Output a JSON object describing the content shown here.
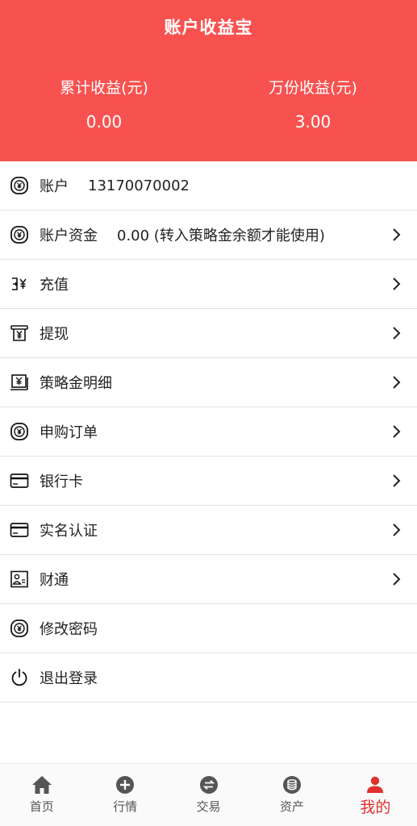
{
  "header": {
    "title": "账户收益宝",
    "stats": [
      {
        "label": "累计收益(元)",
        "value": "0.00"
      },
      {
        "label": "万份收益(元)",
        "value": "3.00"
      }
    ]
  },
  "menu": {
    "items": [
      {
        "label": "账户",
        "value": "13170070002",
        "icon": "yen-coin-icon",
        "chevron": false
      },
      {
        "label": "账户资金",
        "value": "0.00 (转入策略金余额才能使用)",
        "icon": "yen-coin-icon",
        "chevron": true
      },
      {
        "label": "充值",
        "value": "",
        "icon": "recharge-icon",
        "chevron": true
      },
      {
        "label": "提现",
        "value": "",
        "icon": "withdraw-icon",
        "chevron": true
      },
      {
        "label": "策略金明细",
        "value": "",
        "icon": "bill-detail-icon",
        "chevron": true
      },
      {
        "label": "申购订单",
        "value": "",
        "icon": "yen-coin-icon",
        "chevron": true
      },
      {
        "label": "银行卡",
        "value": "",
        "icon": "bank-card-icon",
        "chevron": true
      },
      {
        "label": "实名认证",
        "value": "",
        "icon": "id-card-icon",
        "chevron": true
      },
      {
        "label": "财通",
        "value": "",
        "icon": "profile-card-icon",
        "chevron": true
      },
      {
        "label": "修改密码",
        "value": "",
        "icon": "yen-coin-icon",
        "chevron": false
      },
      {
        "label": "退出登录",
        "value": "",
        "icon": "power-icon",
        "chevron": false
      }
    ]
  },
  "tabbar": {
    "items": [
      {
        "label": "首页",
        "icon": "home-icon",
        "active": false
      },
      {
        "label": "行情",
        "icon": "plus-circle-icon",
        "active": false
      },
      {
        "label": "交易",
        "icon": "exchange-icon",
        "active": false
      },
      {
        "label": "资产",
        "icon": "database-icon",
        "active": false
      },
      {
        "label": "我的",
        "icon": "user-icon",
        "active": true
      }
    ]
  },
  "colors": {
    "header_bg": "#f75250",
    "active_tab": "#e2302c",
    "divider": "#e4e4e4"
  }
}
